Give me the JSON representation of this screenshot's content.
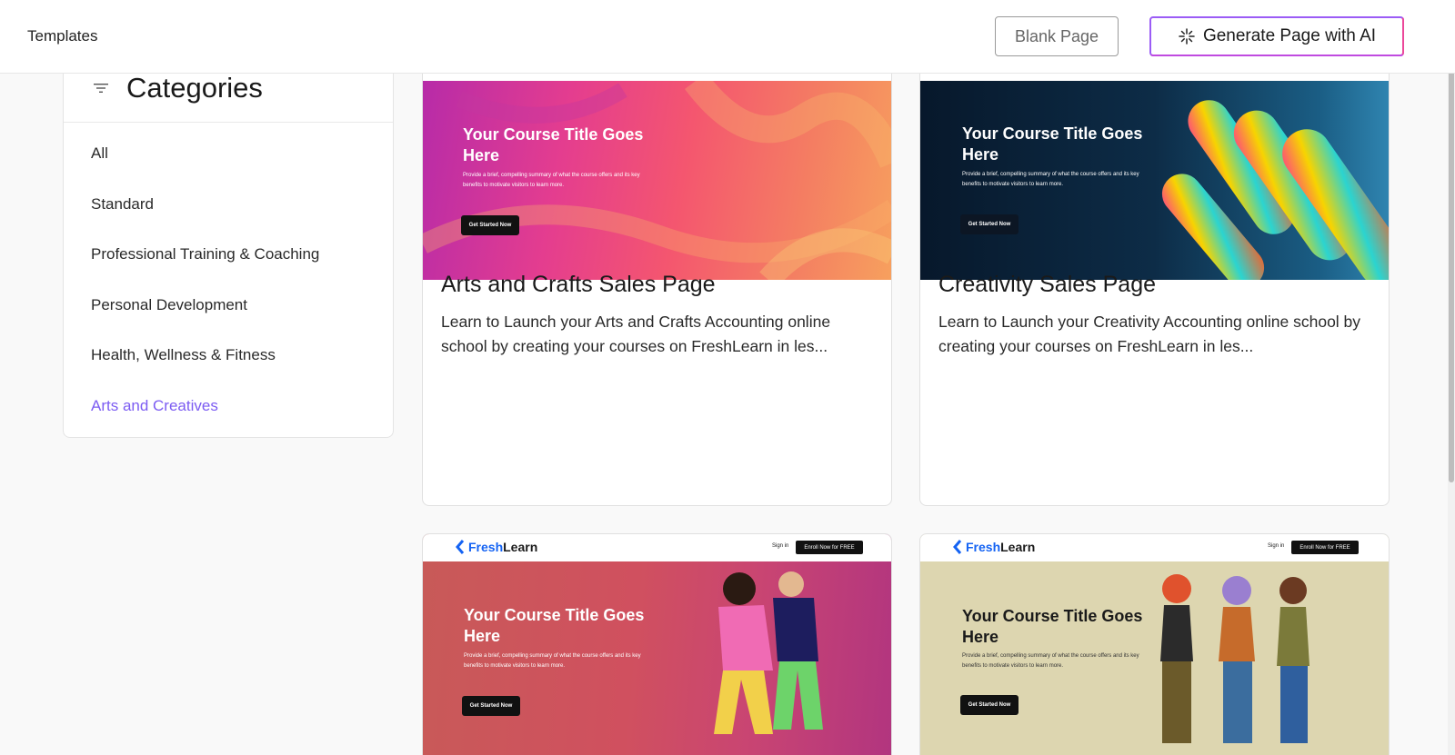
{
  "header": {
    "title": "Templates",
    "blank_page_label": "Blank Page",
    "generate_ai_label": "Generate Page with AI"
  },
  "sidebar": {
    "heading": "Categories",
    "items": [
      {
        "label": "All"
      },
      {
        "label": "Standard"
      },
      {
        "label": "Professional Training & Coaching"
      },
      {
        "label": "Personal Development"
      },
      {
        "label": "Health, Wellness & Fitness"
      },
      {
        "label": "Arts and Creatives",
        "active": true
      }
    ]
  },
  "colors": {
    "accent": "#7c5cf2",
    "ai_border_start": "#9b5cf6",
    "ai_border_end": "#ec4899",
    "brand_blue": "#1463f3"
  },
  "templates": [
    {
      "title": "Arts and Crafts Sales Page",
      "description": "Learn to Launch your Arts and Crafts Accounting online school by creating your courses on FreshLearn in les...",
      "preview": {
        "hero_title": "Your Course Title Goes Here",
        "hero_subtitle": "Provide a brief, compelling summary of what the course offers and its key benefits to motivate visitors to learn more.",
        "cta": "Get Started Now"
      }
    },
    {
      "title": "Creativity Sales Page",
      "description": "Learn to Launch your Creativity Accounting online school by creating your courses on FreshLearn in les...",
      "preview": {
        "hero_title": "Your Course Title Goes Here",
        "hero_subtitle": "Provide a brief, compelling summary of what the course offers and its key benefits to motivate visitors to learn more.",
        "cta": "Get Started Now"
      }
    },
    {
      "preview": {
        "brand_fresh": "Fresh",
        "brand_learn": "Learn",
        "signin": "Sign in",
        "enroll": "Enroll Now for FREE",
        "hero_title": "Your Course Title Goes Here",
        "hero_subtitle": "Provide a brief, compelling summary of what the course offers and its key benefits to motivate visitors to learn more.",
        "cta": "Get Started Now"
      }
    },
    {
      "preview": {
        "brand_fresh": "Fresh",
        "brand_learn": "Learn",
        "signin": "Sign in",
        "enroll": "Enroll Now for FREE",
        "hero_title": "Your Course Title Goes Here",
        "hero_subtitle": "Provide a brief, compelling summary of what the course offers and its key benefits to motivate visitors to learn more.",
        "cta": "Get Started Now"
      }
    }
  ]
}
